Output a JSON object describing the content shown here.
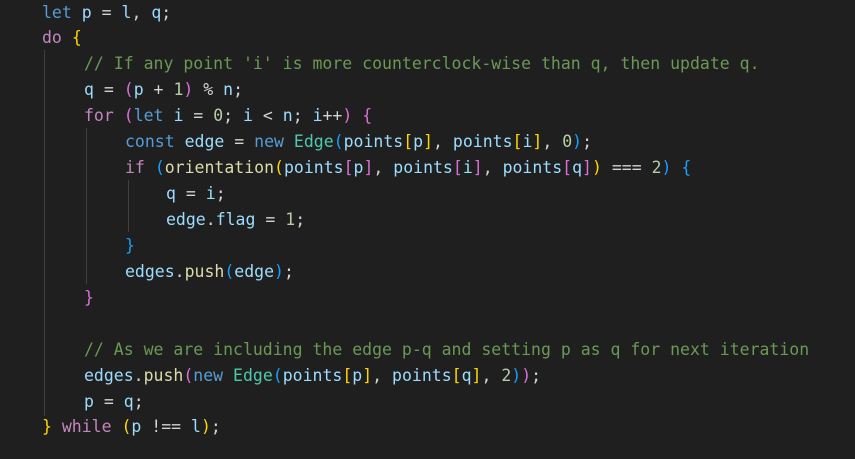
{
  "editor": {
    "language": "javascript",
    "theme_colors": {
      "background": "#1f1f1f",
      "keyword_control": "#c586c0",
      "keyword": "#569cd6",
      "variable": "#9cdcfe",
      "class": "#4ec9b0",
      "function": "#dcdcaa",
      "number": "#b5cea8",
      "comment": "#6a9955",
      "bracket_1": "#ffd700",
      "bracket_2": "#da70d6",
      "bracket_3": "#179fff"
    },
    "lines": [
      [
        [
          "kw",
          "let"
        ],
        [
          "op",
          " "
        ],
        [
          "var",
          "p"
        ],
        [
          "op",
          " = "
        ],
        [
          "var",
          "l"
        ],
        [
          "op",
          ", "
        ],
        [
          "var",
          "q"
        ],
        [
          "op",
          ";"
        ]
      ],
      [
        [
          "kw-ctrl",
          "do"
        ],
        [
          "op",
          " "
        ],
        [
          "b1",
          "{"
        ]
      ],
      [
        [
          "cmt",
          "// If any point 'i' is more counterclock-wise than q, then update q."
        ]
      ],
      [
        [
          "var",
          "q"
        ],
        [
          "op",
          " = "
        ],
        [
          "b2",
          "("
        ],
        [
          "var",
          "p"
        ],
        [
          "op",
          " + "
        ],
        [
          "num",
          "1"
        ],
        [
          "b2",
          ")"
        ],
        [
          "op",
          " % "
        ],
        [
          "var",
          "n"
        ],
        [
          "op",
          ";"
        ]
      ],
      [
        [
          "kw-ctrl",
          "for"
        ],
        [
          "op",
          " "
        ],
        [
          "b2",
          "("
        ],
        [
          "kw",
          "let"
        ],
        [
          "op",
          " "
        ],
        [
          "var",
          "i"
        ],
        [
          "op",
          " = "
        ],
        [
          "num",
          "0"
        ],
        [
          "op",
          "; "
        ],
        [
          "var",
          "i"
        ],
        [
          "op",
          " < "
        ],
        [
          "var",
          "n"
        ],
        [
          "op",
          "; "
        ],
        [
          "var",
          "i"
        ],
        [
          "op",
          "++"
        ],
        [
          "b2",
          ")"
        ],
        [
          "op",
          " "
        ],
        [
          "b2",
          "{"
        ]
      ],
      [
        [
          "kw",
          "const"
        ],
        [
          "op",
          " "
        ],
        [
          "var",
          "edge"
        ],
        [
          "op",
          " = "
        ],
        [
          "kw",
          "new"
        ],
        [
          "op",
          " "
        ],
        [
          "cls",
          "Edge"
        ],
        [
          "b3",
          "("
        ],
        [
          "var",
          "points"
        ],
        [
          "b1",
          "["
        ],
        [
          "var",
          "p"
        ],
        [
          "b1",
          "]"
        ],
        [
          "op",
          ", "
        ],
        [
          "var",
          "points"
        ],
        [
          "b1",
          "["
        ],
        [
          "var",
          "i"
        ],
        [
          "b1",
          "]"
        ],
        [
          "op",
          ", "
        ],
        [
          "num",
          "0"
        ],
        [
          "b3",
          ")"
        ],
        [
          "op",
          ";"
        ]
      ],
      [
        [
          "kw-ctrl",
          "if"
        ],
        [
          "op",
          " "
        ],
        [
          "b3",
          "("
        ],
        [
          "fn",
          "orientation"
        ],
        [
          "b1",
          "("
        ],
        [
          "var",
          "points"
        ],
        [
          "b2",
          "["
        ],
        [
          "var",
          "p"
        ],
        [
          "b2",
          "]"
        ],
        [
          "op",
          ", "
        ],
        [
          "var",
          "points"
        ],
        [
          "b2",
          "["
        ],
        [
          "var",
          "i"
        ],
        [
          "b2",
          "]"
        ],
        [
          "op",
          ", "
        ],
        [
          "var",
          "points"
        ],
        [
          "b2",
          "["
        ],
        [
          "var",
          "q"
        ],
        [
          "b2",
          "]"
        ],
        [
          "b1",
          ")"
        ],
        [
          "op",
          " === "
        ],
        [
          "num",
          "2"
        ],
        [
          "b3",
          ")"
        ],
        [
          "op",
          " "
        ],
        [
          "b3",
          "{"
        ]
      ],
      [
        [
          "var",
          "q"
        ],
        [
          "op",
          " = "
        ],
        [
          "var",
          "i"
        ],
        [
          "op",
          ";"
        ]
      ],
      [
        [
          "var",
          "edge"
        ],
        [
          "op",
          "."
        ],
        [
          "var",
          "flag"
        ],
        [
          "op",
          " = "
        ],
        [
          "num",
          "1"
        ],
        [
          "op",
          ";"
        ]
      ],
      [
        [
          "b3",
          "}"
        ]
      ],
      [
        [
          "var",
          "edges"
        ],
        [
          "op",
          "."
        ],
        [
          "fn",
          "push"
        ],
        [
          "b3",
          "("
        ],
        [
          "var",
          "edge"
        ],
        [
          "b3",
          ")"
        ],
        [
          "op",
          ";"
        ]
      ],
      [
        [
          "b2",
          "}"
        ]
      ],
      [],
      [
        [
          "cmt",
          "// As we are including the edge p-q and setting p as q for next iteration"
        ]
      ],
      [
        [
          "var",
          "edges"
        ],
        [
          "op",
          "."
        ],
        [
          "fn",
          "push"
        ],
        [
          "b2",
          "("
        ],
        [
          "kw",
          "new"
        ],
        [
          "op",
          " "
        ],
        [
          "cls",
          "Edge"
        ],
        [
          "b3",
          "("
        ],
        [
          "var",
          "points"
        ],
        [
          "b1",
          "["
        ],
        [
          "var",
          "p"
        ],
        [
          "b1",
          "]"
        ],
        [
          "op",
          ", "
        ],
        [
          "var",
          "points"
        ],
        [
          "b1",
          "["
        ],
        [
          "var",
          "q"
        ],
        [
          "b1",
          "]"
        ],
        [
          "op",
          ", "
        ],
        [
          "num",
          "2"
        ],
        [
          "b3",
          ")"
        ],
        [
          "b2",
          ")"
        ],
        [
          "op",
          ";"
        ]
      ],
      [
        [
          "var",
          "p"
        ],
        [
          "op",
          " = "
        ],
        [
          "var",
          "q"
        ],
        [
          "op",
          ";"
        ]
      ],
      [
        [
          "b1",
          "}"
        ],
        [
          "op",
          " "
        ],
        [
          "kw-ctrl",
          "while"
        ],
        [
          "op",
          " "
        ],
        [
          "b1",
          "("
        ],
        [
          "var",
          "p"
        ],
        [
          "op",
          " !== "
        ],
        [
          "var",
          "l"
        ],
        [
          "b1",
          ")"
        ],
        [
          "op",
          ";"
        ]
      ]
    ]
  }
}
